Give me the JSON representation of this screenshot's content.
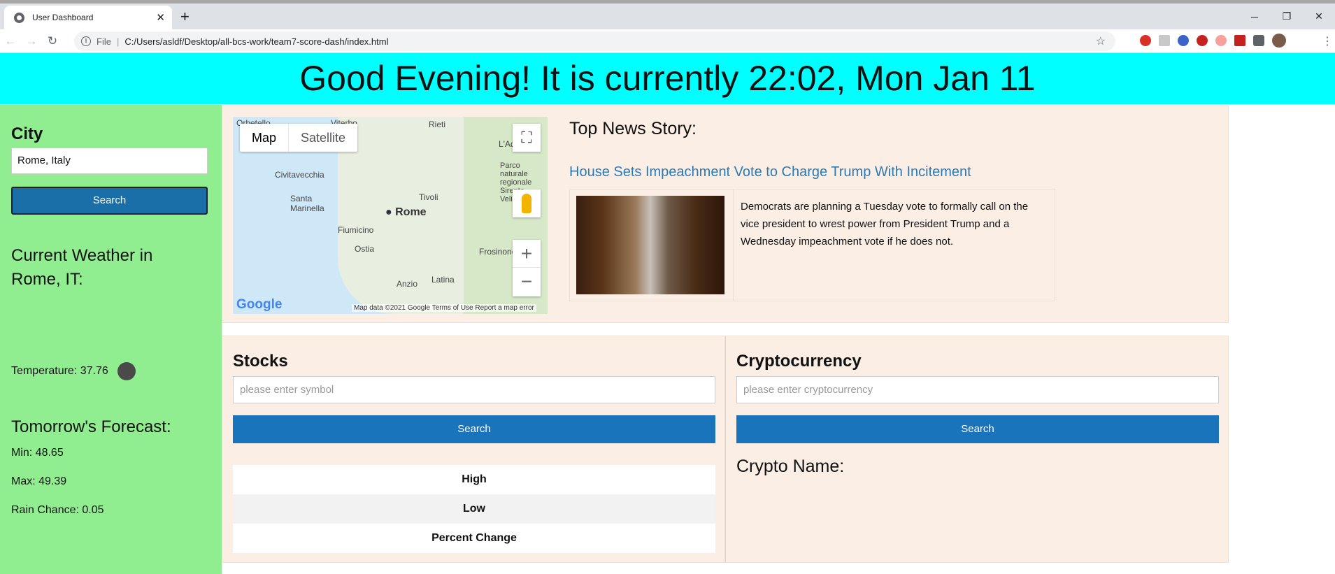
{
  "browser": {
    "tab_title": "User Dashboard",
    "url_scheme": "File",
    "url": "C:/Users/asldf/Desktop/all-bcs-work/team7-score-dash/index.html"
  },
  "greeting": "Good Evening! It is currently 22:02, Mon Jan 11",
  "sidebar": {
    "city_label": "City",
    "city_value": "Rome, Italy",
    "search_label": "Search",
    "weather_title": "Current Weather in Rome, IT:",
    "temperature": "Temperature: 37.76",
    "forecast_title": "Tomorrow's Forecast:",
    "min": "Min: 48.65",
    "max": "Max: 49.39",
    "rain": "Rain Chance: 0.05"
  },
  "map": {
    "type_map": "Map",
    "type_satellite": "Satellite",
    "city": "Rome",
    "labels": [
      "Viterbo",
      "Rieti",
      "Civitavecchia",
      "Tivoli",
      "Santa Marinella",
      "Fiumicino",
      "Ostia",
      "Frosinone",
      "Anzio",
      "Latina",
      "L'Aquila",
      "Parco naturale regionale Sirente-Velino",
      "Orbetello"
    ],
    "logo": "Google",
    "attribution": "Map data ©2021 Google   Terms of Use   Report a map error"
  },
  "news": {
    "heading": "Top News Story:",
    "headline": "House Sets Impeachment Vote to Charge Trump With Incitement",
    "summary": "Democrats are planning a Tuesday vote to formally call on the vice president to wrest power from President Trump and a Wednesday impeachment vote if he does not."
  },
  "stocks": {
    "title": "Stocks",
    "placeholder": "please enter symbol",
    "search_label": "Search",
    "rows": [
      "High",
      "Low",
      "Percent Change"
    ]
  },
  "crypto": {
    "title": "Cryptocurrency",
    "placeholder": "please enter cryptocurrency",
    "search_label": "Search",
    "name_label": "Crypto Name:"
  },
  "colors": {
    "header_bg": "#00ffff",
    "sidebar_bg": "#90ee90",
    "panel_bg": "#faeee5",
    "button_bg": "#1a74bb",
    "link": "#2a7ab8"
  }
}
